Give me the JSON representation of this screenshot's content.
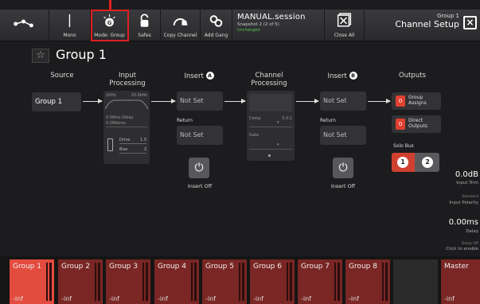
{
  "toolbar": {
    "buttons": [
      {
        "label": "",
        "icon": "routing-icon"
      },
      {
        "label": "Mono",
        "icon": "mono-icon"
      },
      {
        "label": "Mode: Group",
        "icon": "mode-group-icon"
      },
      {
        "label": "Safes",
        "icon": "lock-icon"
      },
      {
        "label": "Copy Channel",
        "icon": "copy-channel-icon"
      },
      {
        "label": "Add Gang",
        "icon": "gang-link-icon"
      }
    ],
    "session_name": "MANUAL.session",
    "snapshot": "Snapshot 2 (2 of 5)",
    "session_status": "Unchanged",
    "close_all_label": "Close All",
    "title_group": "Group 1",
    "title": "Channel Setup"
  },
  "header": {
    "title": "Group 1"
  },
  "columns": {
    "source": "Source",
    "input_processing": "Input\nProcessing",
    "insert_a": "Insert",
    "channel_processing": "Channel\nProcessing",
    "insert_b": "Insert",
    "outputs": "Outputs"
  },
  "source": {
    "value": "Group 1"
  },
  "input_processing": {
    "hpf": "20Hz",
    "lpf": "20.0kHz",
    "delay": "0.00ms Delay",
    "delay2": "0.0Metres",
    "drive_label": "Drive",
    "drive_value": "1.0",
    "bias_label": "Bias",
    "bias_value": "3"
  },
  "insert_a": {
    "send": "Not Set",
    "return_label": "Return",
    "return": "Not Set",
    "state": "Insert Off",
    "badge": "A"
  },
  "channel_processing": {
    "comp_label": "Comp",
    "comp_value": "3.0:1",
    "gate_label": "Gate"
  },
  "insert_b": {
    "send": "Not Set",
    "return_label": "Return",
    "return": "Not Set",
    "state": "Insert Off",
    "badge": "B"
  },
  "outputs": {
    "group_assigns_count": "0",
    "group_assigns_label": "Group\nAssigns",
    "direct_outputs_count": "0",
    "direct_outputs_label": "Direct\nOutputs",
    "solo_bus_label": "Solo Bus",
    "solo_1": "1",
    "solo_2": "2"
  },
  "right_panel": {
    "input_trim_value": "0.0dB",
    "input_trim_label": "Input Trim",
    "polarity_state": "Standard",
    "polarity_label": "Input Polarity",
    "delay_value": "0.00ms",
    "delay_label": "Delay",
    "delay_hint1": "Delay Off",
    "delay_hint2": "Click to enable"
  },
  "channels": [
    {
      "name": "Group 1",
      "level": "-inf"
    },
    {
      "name": "Group 2",
      "level": "-inf"
    },
    {
      "name": "Group 3",
      "level": "-inf"
    },
    {
      "name": "Group 4",
      "level": "-inf"
    },
    {
      "name": "Group 5",
      "level": "-inf"
    },
    {
      "name": "Group 6",
      "level": "-inf"
    },
    {
      "name": "Group 7",
      "level": "-inf"
    },
    {
      "name": "Group 8",
      "level": "-inf"
    },
    {
      "name": "Master",
      "level": "-inf"
    }
  ],
  "colors": {
    "accent_red": "#e44b3f",
    "channel_red": "#7a2624",
    "highlight": "#e02020",
    "status_green": "#4fc34f"
  }
}
